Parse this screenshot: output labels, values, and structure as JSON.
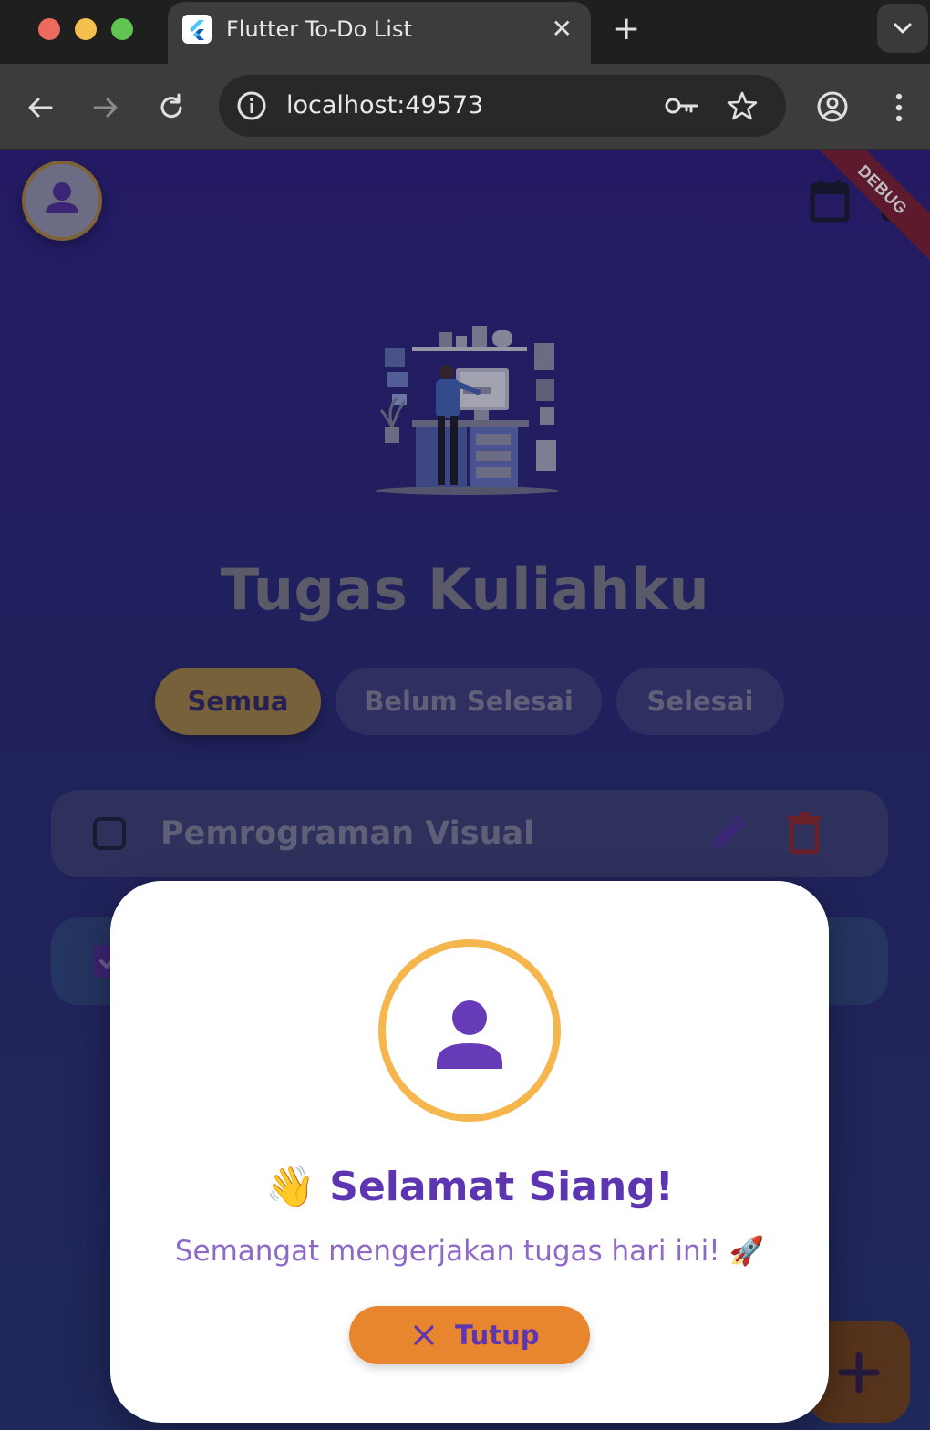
{
  "browser": {
    "tab_title": "Flutter To-Do List",
    "tab_close": "✕",
    "new_tab": "+",
    "url": "localhost:49573"
  },
  "app": {
    "debug_label": "DEBUG",
    "title": "Tugas Kuliahku",
    "filters": [
      "Semua",
      "Belum Selesai",
      "Selesai"
    ],
    "active_filter": "Semua",
    "tasks": [
      {
        "label": "Pemrograman Visual",
        "done": false
      },
      {
        "label": "",
        "done": true
      }
    ]
  },
  "dialog": {
    "title": "👋 Selamat Siang!",
    "subtitle": "Semangat mengerjakan tugas hari ini! 🚀",
    "close_label": "Tutup"
  },
  "colors": {
    "accent_purple": "#5e35b1",
    "accent_orange": "#e8852f",
    "ring_gold": "#f6b64e"
  },
  "icons": [
    "user-icon",
    "calendar-icon",
    "edit-icon",
    "trash-icon",
    "add-icon",
    "close-icon"
  ]
}
